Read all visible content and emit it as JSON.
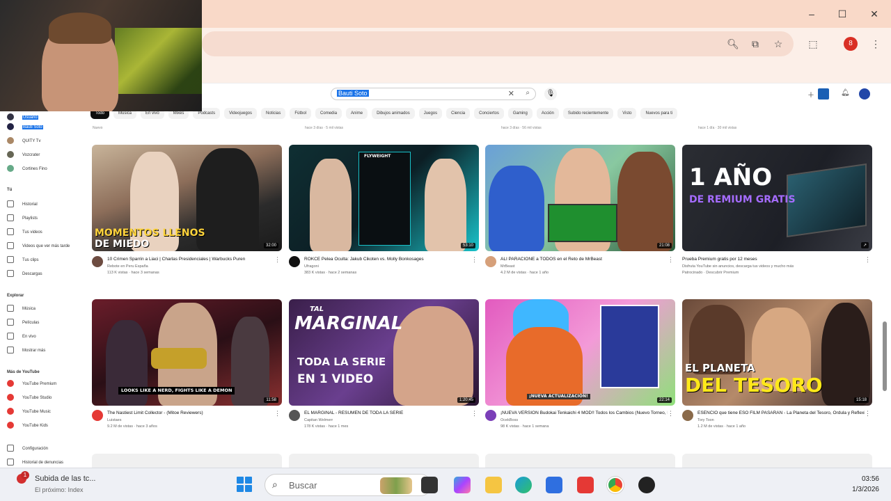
{
  "browser": {
    "window_controls": [
      "–",
      "☐",
      "✕"
    ],
    "profile_initial": "8"
  },
  "youtube": {
    "search_query": "Bauti Soto",
    "chips": [
      "Todo",
      "Música",
      "En vivo",
      "Mixes",
      "Podcasts",
      "Videojuegos",
      "Noticias",
      "Fútbol",
      "Comedia",
      "Anime",
      "Dibujos animados",
      "Juegos",
      "Ciencia",
      "Conciertos",
      "Gaming",
      "Acción",
      "Subido recientemente",
      "Visto",
      "Nuevos para ti"
    ],
    "prev_row_meta": [
      "Nuevo",
      "hace 3 días · 5 mil vistas",
      "hace 3 días · 56 mil vistas",
      "hace 1 día · 30 mil vistas"
    ],
    "sidebar": {
      "top_items": [
        "Usuario",
        "Bauti Soto",
        "QUITY Tv",
        "Vozcrater",
        "Cortines Fino"
      ],
      "you_title": "Tú",
      "you_items": [
        "Historial",
        "Playlists",
        "Tus videos",
        "Videos que ver más tarde",
        "Tus clips",
        "Descargas"
      ],
      "explore_title": "Explorar",
      "explore_items": [
        "Música",
        "Películas",
        "En vivo",
        "Mostrar más"
      ],
      "more_title": "Más de YouTube",
      "more_items": [
        "YouTube Premium",
        "YouTube Studio",
        "YouTube Music",
        "YouTube Kids"
      ],
      "settings_items": [
        "Configuración",
        "Historial de denuncias"
      ]
    },
    "videos": [
      {
        "overlay1": "MOMENTOS LLENOS",
        "overlay2": "DE MIEDO",
        "duration": "32:00",
        "title": "10 Crimen Sparrin a Liaci | Charlas Presidenciales | Warbucks Puren",
        "channel": "Rebote en Peru España",
        "stats": "113 K vistas · hace 3 semanas"
      },
      {
        "overlay1": "FLYWEIGHT",
        "overlay2": "",
        "duration": "53:10",
        "title": "ROKCE Pelea Oculta: Jakub Cikoten vs. Molly Bonkosages",
        "channel": "Ufragoni",
        "stats": "383 K vistas · hace 2 semanas"
      },
      {
        "overlay1": "",
        "overlay2": "",
        "duration": "21:08",
        "title": "ALI PARACIONE a TODOS en el Reto de MrBeast",
        "channel": "MrBeast",
        "stats": "4.2 M de vistas · hace 1 año"
      },
      {
        "overlay1": "1 AÑO",
        "overlay2": "DE REMIUM GRATIS",
        "duration": "↗",
        "title": "Prueba Premium gratis por 12 meses",
        "channel": "Disfruta YouTube sin anuncios, descarga tus videos y mucho más",
        "stats": "Patrocinado · Descubrir Premium"
      },
      {
        "overlay1": "LOOKS LIKE A NERD, FIGHTS LIKE A DEMON",
        "overlay2": "",
        "duration": "11:58",
        "title": "The Nastiest Limit Collector - (Mitoe Reviewers)",
        "channel": "Luistaes",
        "stats": "9.2 M de vistas · hace 3 años"
      },
      {
        "overlay1": "TAL",
        "overlay2": "MARGINAL",
        "overlay3": "TODA LA SERIE",
        "overlay4": "EN 1 VIDEO",
        "duration": "1:20:45",
        "title": "EL MARGINAL - RESUMEN DE TODA LA SERIE",
        "channel": "Capitan Welmerr",
        "stats": "178 K vistas · hace 1 mes"
      },
      {
        "overlay1": "¡NUEVA ACTUALIZACIÓN!",
        "overlay2": "",
        "duration": "22:14",
        "title": "¡NUEVA VERSIÓN Budokai Tenkaichi 4 MOD!! Todos los Cambios (Nuevo Torneo, Personajes) [PS2]",
        "channel": "OcekBoss",
        "stats": "98 K vistas · hace 1 semana"
      },
      {
        "overlay1": "EL PLANETA",
        "overlay2": "DEL TESORO",
        "duration": "15:18",
        "title": "ESENCIO que tiene ESO FILM PASARAN - La Planeta del Tesoro, Ordula y Reflexiones",
        "channel": "Tory Toon",
        "stats": "1.2 M de vistas · hace 1 año"
      }
    ]
  },
  "taskbar": {
    "notification_count": "1",
    "notification_title": "Subida de las tc...",
    "notification_sub": "El próximo: Index",
    "search_placeholder": "Buscar",
    "time": "03:56",
    "date": "1/3/2026"
  }
}
